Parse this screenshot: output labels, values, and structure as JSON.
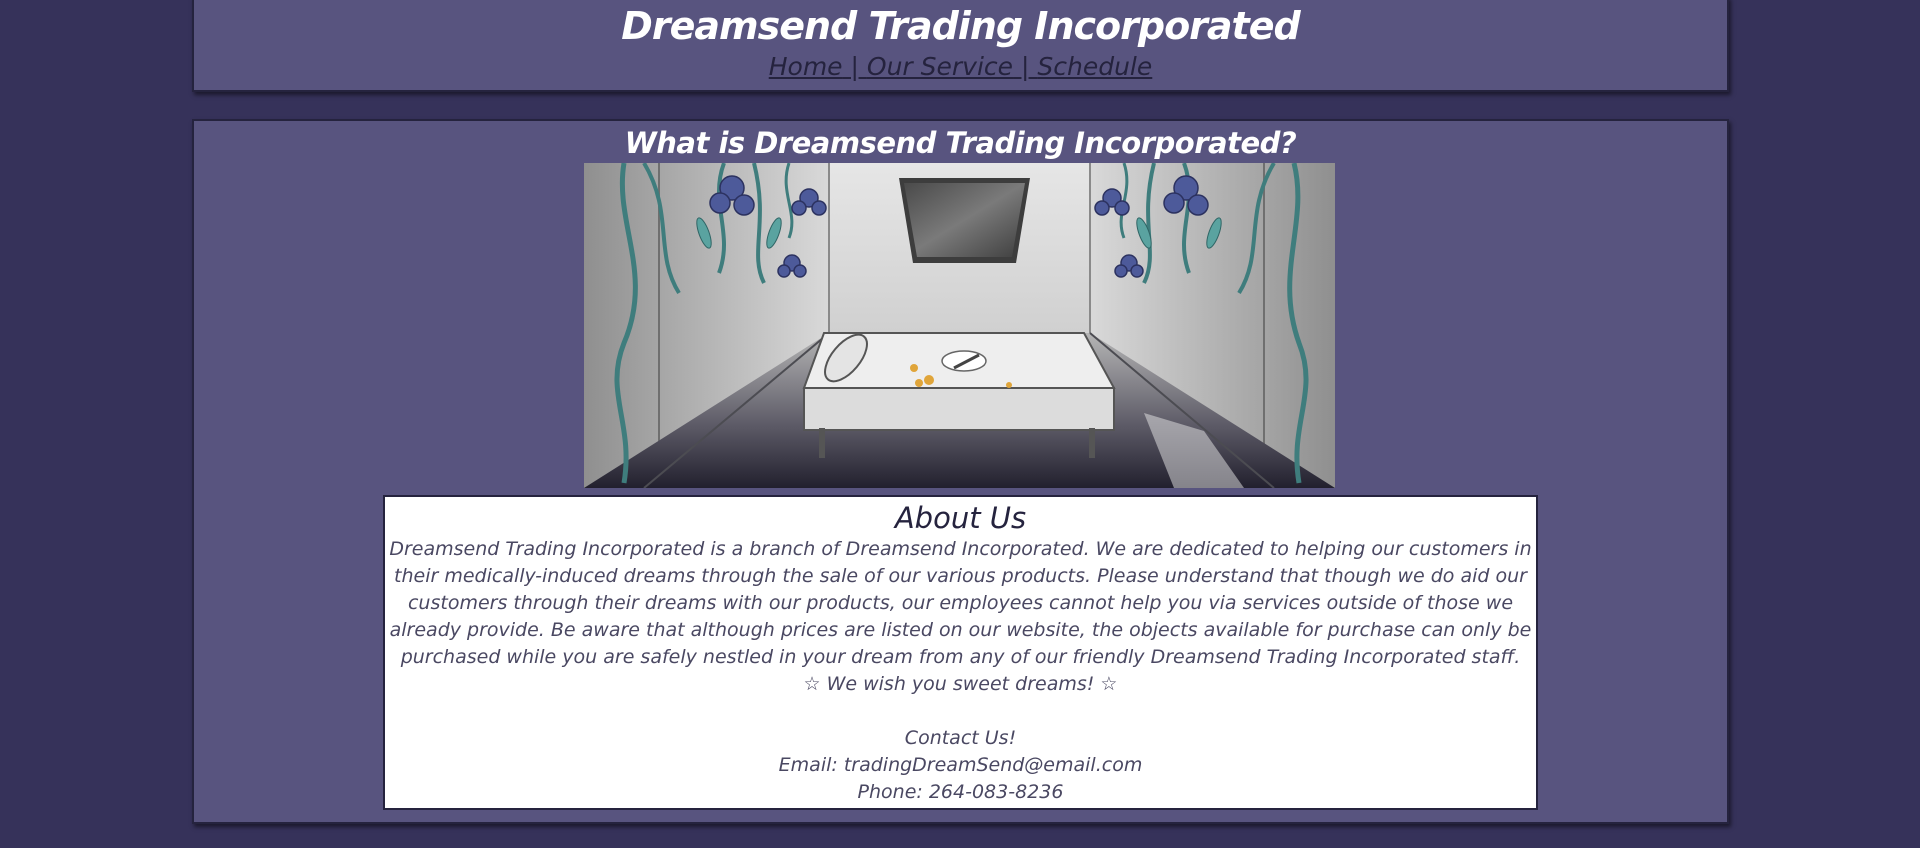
{
  "header": {
    "title": "Dreamsend Trading Incorporated",
    "nav": {
      "home": "Home",
      "separator1": " | ",
      "service": "Our Service",
      "separator2": " | ",
      "schedule": "Schedule"
    }
  },
  "main": {
    "heading": "What is Dreamsend Trading Incorporated?",
    "about": {
      "title": "About Us",
      "paragraph": "Dreamsend Trading Incorporated is a branch of Dreamsend Incorporated. We are dedicated to helping our customers in their medically-induced dreams through the sale of our various products. Please understand that though we do aid our customers through their dreams with our products, our employees cannot help you via services outside of those we already provide. Be aware that although prices are listed on our website, the objects available for purchase can only be purchased while you are safely nestled in your dream from any of our friendly Dreamsend Trading Incorporated staff.",
      "wish": "☆ We wish you sweet dreams! ☆",
      "contact_heading": "Contact Us!",
      "email": "Email: tradingDreamSend@email.com",
      "phone": "Phone: 264-083-8236"
    }
  },
  "colors": {
    "page_background": "#36325a",
    "panel_background": "#58547f",
    "panel_border": "#25233e",
    "heading_text": "#ffffff",
    "body_text": "#4a4862"
  }
}
